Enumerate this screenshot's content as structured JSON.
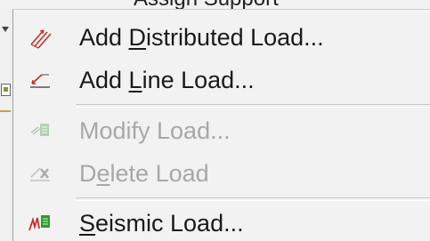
{
  "header": {
    "cutoff_text": "Assign Support"
  },
  "menu": {
    "items": [
      {
        "before": "Add ",
        "mnemonic": "D",
        "after": "istributed Load...",
        "icon": "distributed-load-icon",
        "enabled": true
      },
      {
        "before": "Add ",
        "mnemonic": "L",
        "after": "ine Load...",
        "icon": "line-load-icon",
        "enabled": true
      },
      {
        "before": "Modify Load...",
        "mnemonic": "",
        "after": "",
        "icon": "modify-load-icon",
        "enabled": false
      },
      {
        "before": "D",
        "mnemonic": "e",
        "after": "lete Load",
        "icon": "delete-load-icon",
        "enabled": false
      },
      {
        "before": "",
        "mnemonic": "S",
        "after": "eismic Load...",
        "icon": "seismic-load-icon",
        "enabled": true
      }
    ]
  },
  "colors": {
    "menu_background": "#f2f2f2",
    "text": "#1a1a1a",
    "disabled_text": "#a8a8a8",
    "separator": "#c8c8c8",
    "icon_red": "#c0302a",
    "icon_green": "#2e9a2e"
  }
}
